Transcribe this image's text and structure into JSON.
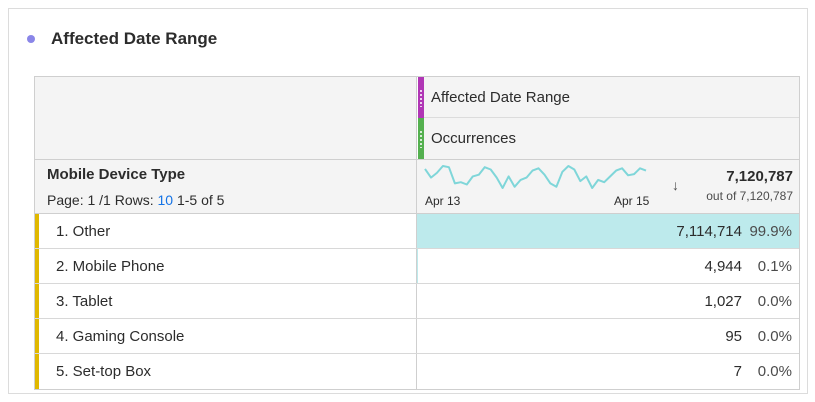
{
  "panel": {
    "title": "Affected Date Range",
    "accent_color": "#8a86e8"
  },
  "table": {
    "header": {
      "dimension_breakdown": {
        "label": "Affected Date Range",
        "color": "#b036b5"
      },
      "metric": {
        "label": "Occurrences",
        "color": "#54b04f"
      }
    },
    "dimension": {
      "title": "Mobile Device Type",
      "page_prefix": "Page: 1 /1 Rows:",
      "rows_per_page": "10",
      "range": "1-5 of 5"
    },
    "summary": {
      "date_start": "Apr 13",
      "date_end": "Apr 15",
      "sort_icon": "arrow-down-icon",
      "total": "7,120,787",
      "out_of": "out of 7,120,787",
      "sparkline_color": "#7fd6d9",
      "sparkline_values": [
        55,
        40,
        48,
        60,
        58,
        30,
        32,
        28,
        42,
        45,
        58,
        54,
        40,
        22,
        42,
        24,
        36,
        40,
        52,
        56,
        45,
        30,
        24,
        50,
        60,
        54,
        34,
        42,
        22,
        36,
        32,
        42,
        52,
        56,
        44,
        46,
        56,
        52
      ]
    },
    "rows": [
      {
        "label": "1. Other",
        "value": "7,114,714",
        "pct": "99.9%",
        "share": 0.999
      },
      {
        "label": "2. Mobile Phone",
        "value": "4,944",
        "pct": "0.1%",
        "share": 0.001
      },
      {
        "label": "3. Tablet",
        "value": "1,027",
        "pct": "0.0%",
        "share": 0.0
      },
      {
        "label": "4. Gaming Console",
        "value": "95",
        "pct": "0.0%",
        "share": 0.0
      },
      {
        "label": "5. Set-top Box",
        "value": "7",
        "pct": "0.0%",
        "share": 0.0
      }
    ],
    "row_marker_color": "#e0b800",
    "bar_fill_color": "#bdeaec"
  }
}
